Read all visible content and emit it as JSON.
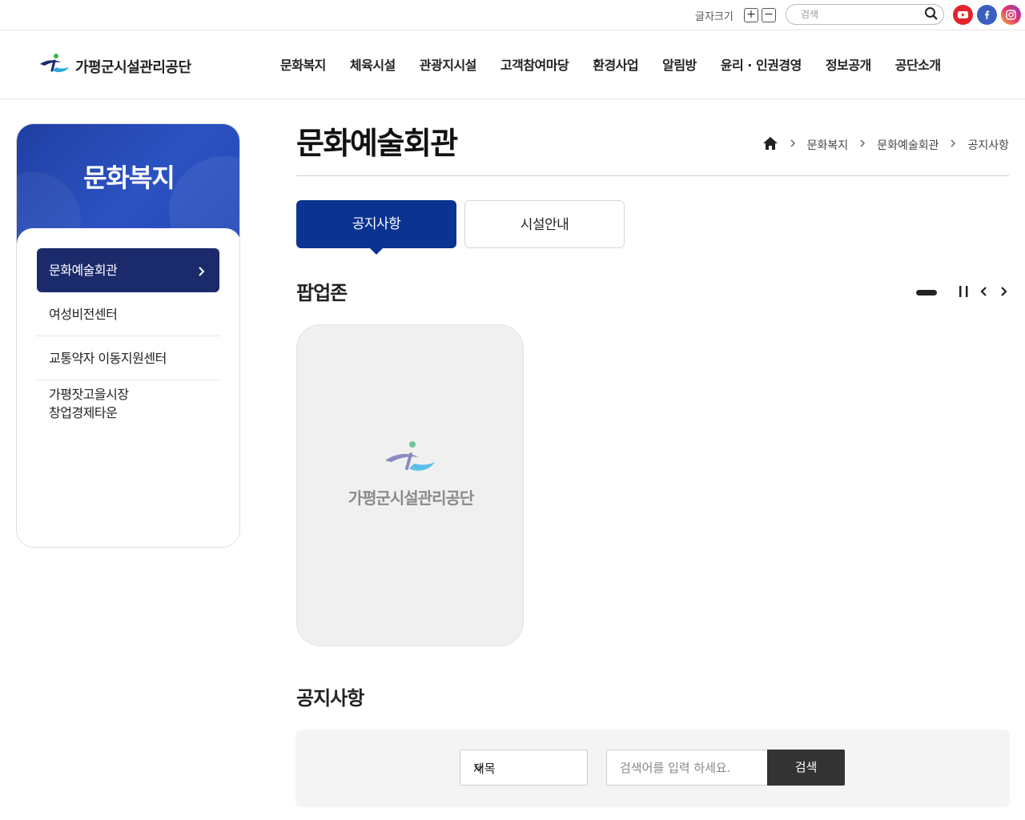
{
  "util": {
    "font_size_label": "글자크기",
    "font_plus": "+",
    "font_minus": "−",
    "search_placeholder": "검색",
    "sns": [
      "youtube-icon",
      "facebook-icon",
      "instagram-icon"
    ]
  },
  "header": {
    "logo_text": "가평군시설관리공단",
    "nav": [
      "문화복지",
      "체육시설",
      "관광지시설",
      "고객참여마당",
      "환경사업",
      "알림방",
      "윤리 · 인권경영",
      "정보공개",
      "공단소개"
    ]
  },
  "sidebar": {
    "title": "문화복지",
    "items": [
      {
        "label": "문화예술회관",
        "active": true
      },
      {
        "label": "여성비전센터"
      },
      {
        "label": "교통약자 이동지원센터"
      },
      {
        "label_line1": "가평잣고을시장",
        "label_line2": "창업경제타운"
      }
    ]
  },
  "content": {
    "page_title": "문화예술회관",
    "breadcrumb": [
      "문화복지",
      "문화예술회관",
      "공지사항"
    ],
    "tabs": [
      "공지사항",
      "시설안내"
    ],
    "popup_title": "팝업존",
    "popup_logo_text": "가평군시설관리공단",
    "notice_title": "공지사항",
    "search": {
      "select_value": "제목",
      "placeholder": "검색어를 입력 하세요.",
      "button": "검색"
    }
  },
  "colors": {
    "primary": "#0b3391",
    "sidebar_active": "#1b2a6b",
    "sidebar_header": "#2c52c2",
    "search_button": "#333333"
  }
}
